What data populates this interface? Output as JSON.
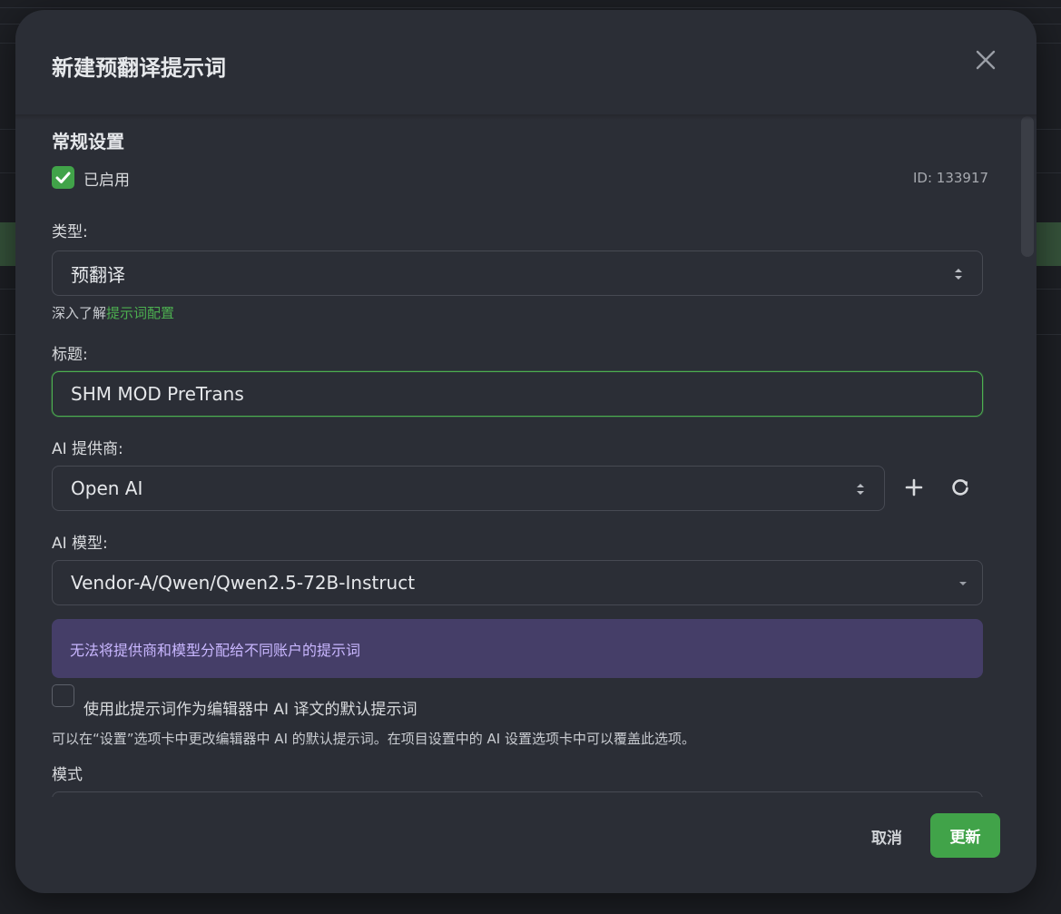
{
  "modal": {
    "title": "新建预翻译提示词",
    "close_icon": "close-icon"
  },
  "general": {
    "section_title": "常规设置",
    "enabled_label": "已启用",
    "enabled_checked": true,
    "id_text": "ID: 133917",
    "type_label": "类型:",
    "type_value": "预翻译",
    "learn_more_prefix": "深入了解",
    "learn_more_link": "提示词配置",
    "title_label": "标题:",
    "title_value": "SHM MOD PreTrans",
    "provider_label": "AI 提供商:",
    "provider_value": "Open AI",
    "model_label": "AI 模型:",
    "model_value": "Vendor-A/Qwen/Qwen2.5-72B-Instruct",
    "notice": "无法将提供商和模型分配给不同账户的提示词",
    "default_label": "使用此提示词作为编辑器中 AI 译文的默认提示词",
    "default_checked": false,
    "default_help": "可以在“设置”选项卡中更改编辑器中 AI 的默认提示词。在项目设置中的 AI 设置选项卡中可以覆盖此选项。",
    "mode_label": "模式"
  },
  "footer": {
    "cancel_label": "取消",
    "update_label": "更新"
  },
  "colors": {
    "accent": "#41a349",
    "notice_bg": "#453e68",
    "notice_text": "#c9b7ff",
    "modal_bg": "#2b2e36"
  }
}
